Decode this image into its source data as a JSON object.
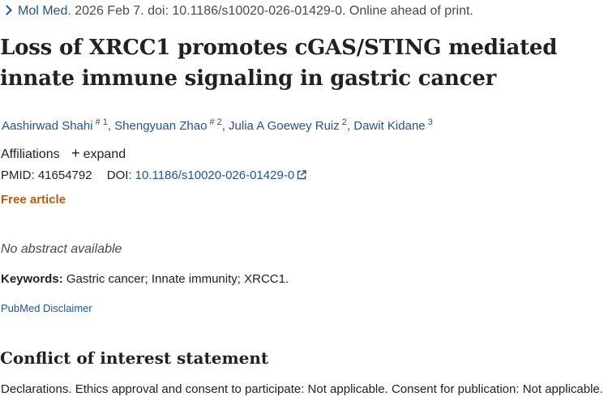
{
  "citation": {
    "journal": "Mol Med.",
    "details": "2026 Feb 7. doi: 10.1186/s10020-026-01429-0. Online ahead of print."
  },
  "title": "Loss of XRCC1 promotes cGAS/STING mediated innate immune signaling in gastric cancer",
  "authors": [
    {
      "name": "Aashirwad Shahi",
      "mark": "#",
      "aff": "1"
    },
    {
      "name": "Shengyuan Zhao",
      "mark": "#",
      "aff": "2"
    },
    {
      "name": "Julia A Goewey Ruiz",
      "mark": "",
      "aff": "2"
    },
    {
      "name": "Dawit Kidane",
      "mark": "",
      "aff": "3"
    }
  ],
  "affiliations": {
    "label": "Affiliations",
    "expand_label": "expand"
  },
  "identifiers": {
    "pmid_label": "PMID:",
    "pmid": "41654792",
    "doi_label": "DOI:",
    "doi": "10.1186/s10020-026-01429-0"
  },
  "free_article": "Free article",
  "abstract_note": "No abstract available",
  "keywords": {
    "label": "Keywords:",
    "text": "Gastric cancer; Innate immunity; XRCC1."
  },
  "disclaimer": "PubMed Disclaimer",
  "conflict": {
    "heading": "Conflict of interest statement",
    "text": "Declarations. Ethics approval and consent to participate: Not applicable. Consent for publication: Not applicable."
  },
  "colors": {
    "link": "#205493",
    "free_article": "#b95b0f",
    "text": "#212121"
  }
}
